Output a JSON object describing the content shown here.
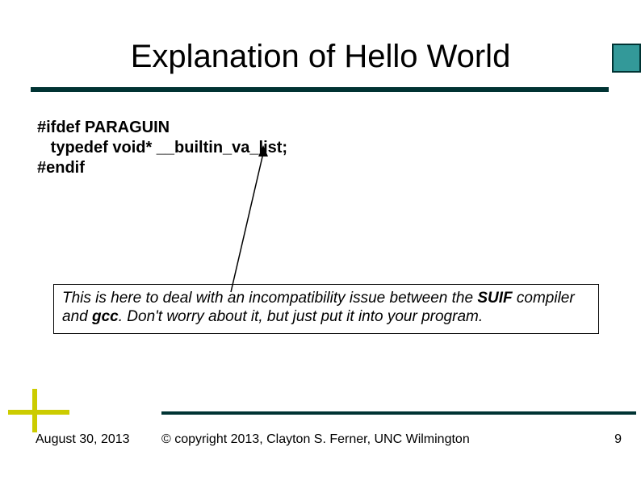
{
  "title": "Explanation of Hello World",
  "code": {
    "line1": "#ifdef PARAGUIN",
    "line2": "   typedef void* __builtin_va_list;",
    "line3": "#endif"
  },
  "note": {
    "pre": "This is here to deal with an incompatibility issue between the ",
    "b1": "SUIF",
    "mid1": " compiler and ",
    "b2": "gcc",
    "post": ".  Don't worry about it, but just put it into your program."
  },
  "footer": {
    "date": "August 30, 2013",
    "copyright": "© copyright 2013, Clayton S. Ferner, UNC Wilmington",
    "page": "9"
  }
}
